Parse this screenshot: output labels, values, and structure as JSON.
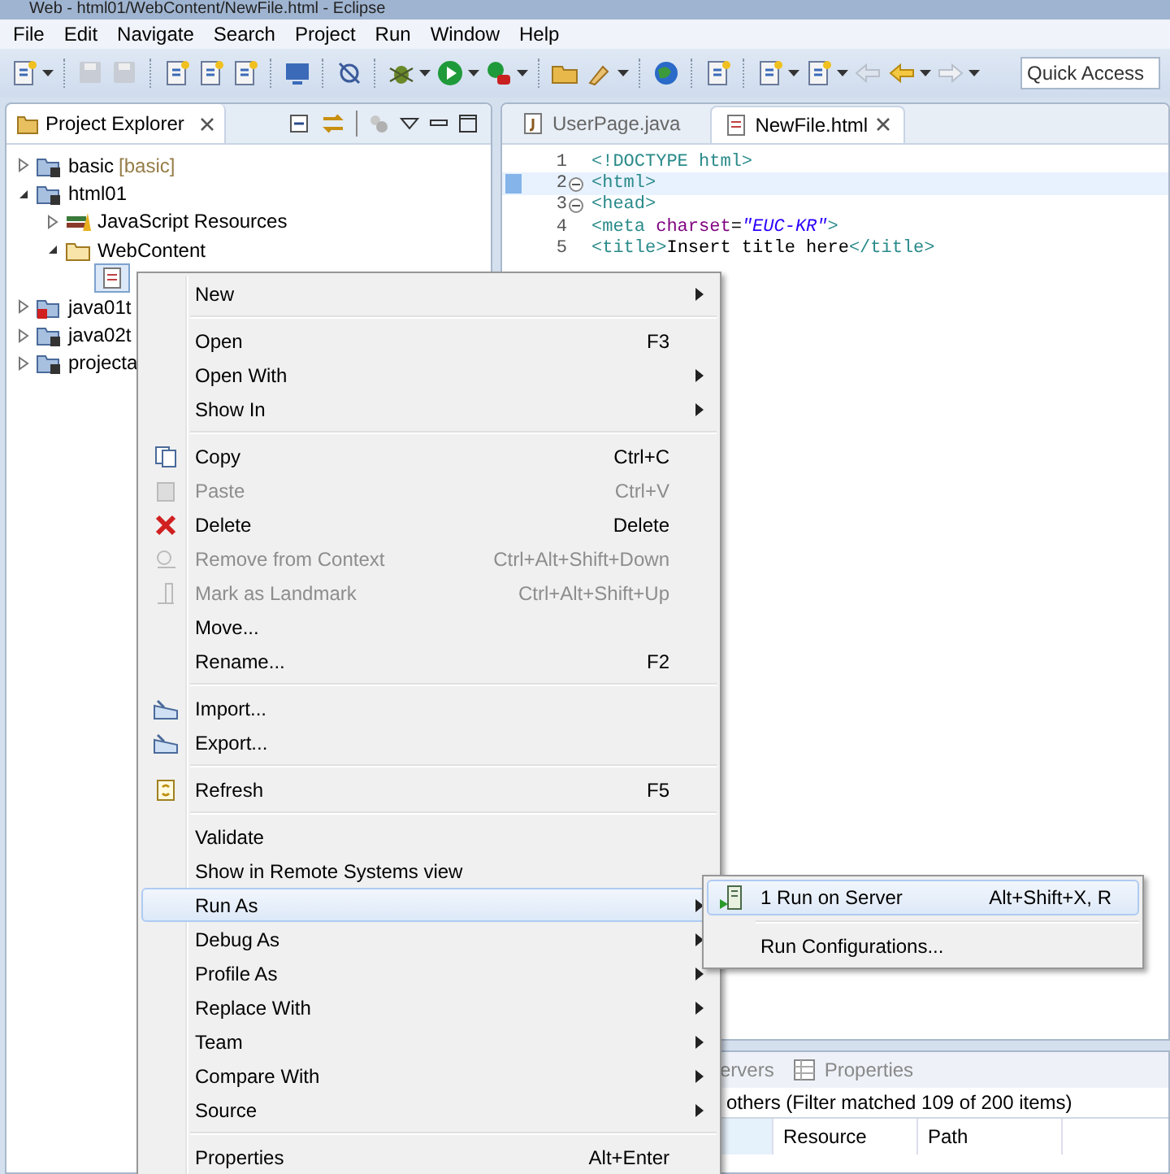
{
  "window": {
    "title": "Web - html01/WebContent/NewFile.html - Eclipse"
  },
  "menu_bar": [
    "File",
    "Edit",
    "Navigate",
    "Search",
    "Project",
    "Run",
    "Window",
    "Help"
  ],
  "toolbar": {
    "search": {
      "placeholder": "Quick Access"
    }
  },
  "project_explorer": {
    "title": "Project Explorer",
    "tree": [
      {
        "label": "basic",
        "suffix": "[basic]",
        "expanded": false
      },
      {
        "label": "html01",
        "expanded": true,
        "children": [
          {
            "label": "JavaScript Resources",
            "expanded": false
          },
          {
            "label": "WebContent",
            "expanded": true,
            "children": [
              {
                "kind": "file",
                "selected": true
              }
            ]
          }
        ]
      },
      {
        "label": "java01t",
        "expanded": false
      },
      {
        "label": "java02t",
        "expanded": false
      },
      {
        "label": "projecta",
        "expanded": false
      }
    ]
  },
  "editor": {
    "tabs": [
      {
        "label": "UserPage.java",
        "selected": false
      },
      {
        "label": "NewFile.html",
        "selected": true
      }
    ],
    "lines": [
      {
        "number": "1",
        "foldable": false,
        "current": false,
        "tokens": [
          {
            "kind": "tag",
            "text": "<!DOCTYPE html>"
          }
        ]
      },
      {
        "number": "2",
        "foldable": true,
        "current": true,
        "tokens": [
          {
            "kind": "tag",
            "text": "<html>"
          }
        ]
      },
      {
        "number": "3",
        "foldable": true,
        "current": false,
        "tokens": [
          {
            "kind": "tag",
            "text": "<head>"
          }
        ]
      },
      {
        "number": "4",
        "foldable": false,
        "current": false,
        "tokens": [
          {
            "kind": "tag",
            "text": "<meta "
          },
          {
            "kind": "attr",
            "text": "charset"
          },
          {
            "kind": "plain",
            "text": "="
          },
          {
            "kind": "value",
            "text": "\"EUC-KR\""
          },
          {
            "kind": "tag",
            "text": ">"
          }
        ]
      },
      {
        "number": "5",
        "foldable": false,
        "current": false,
        "tokens": [
          {
            "kind": "tag",
            "text": "<title>"
          },
          {
            "kind": "plain",
            "text": "Insert title here"
          },
          {
            "kind": "tag",
            "text": "</title>"
          }
        ]
      }
    ]
  },
  "bottom_panel": {
    "tabs": [
      {
        "label": "ervers"
      },
      {
        "label": "Properties"
      }
    ],
    "status": "others (Filter matched 109 of 200 items)",
    "columns": [
      {
        "sorted": true
      },
      {
        "label": "Resource",
        "sorted": false
      },
      {
        "label": "Path",
        "sorted": false
      }
    ]
  },
  "context_menu": {
    "items": [
      {
        "kind": "item",
        "label": "New",
        "submenu": true,
        "disabled": false,
        "selected": false
      },
      {
        "kind": "separator"
      },
      {
        "kind": "item",
        "label": "Open",
        "shortcut": "F3",
        "submenu": false,
        "disabled": false,
        "selected": false
      },
      {
        "kind": "item",
        "label": "Open With",
        "submenu": true,
        "disabled": false,
        "selected": false
      },
      {
        "kind": "item",
        "label": "Show In",
        "submenu": true,
        "disabled": false,
        "selected": false
      },
      {
        "kind": "separator"
      },
      {
        "kind": "item",
        "label": "Copy",
        "shortcut": "Ctrl+C",
        "submenu": false,
        "disabled": false,
        "selected": false
      },
      {
        "kind": "item",
        "label": "Paste",
        "shortcut": "Ctrl+V",
        "submenu": false,
        "disabled": true,
        "selected": false
      },
      {
        "kind": "item",
        "label": "Delete",
        "shortcut": "Delete",
        "submenu": false,
        "disabled": false,
        "selected": false
      },
      {
        "kind": "item",
        "label": "Remove from Context",
        "shortcut": "Ctrl+Alt+Shift+Down",
        "submenu": false,
        "disabled": true,
        "selected": false
      },
      {
        "kind": "item",
        "label": "Mark as Landmark",
        "shortcut": "Ctrl+Alt+Shift+Up",
        "submenu": false,
        "disabled": true,
        "selected": false
      },
      {
        "kind": "item",
        "label": "Move...",
        "submenu": false,
        "disabled": false,
        "selected": false
      },
      {
        "kind": "item",
        "label": "Rename...",
        "shortcut": "F2",
        "submenu": false,
        "disabled": false,
        "selected": false
      },
      {
        "kind": "separator"
      },
      {
        "kind": "item",
        "label": "Import...",
        "submenu": false,
        "disabled": false,
        "selected": false
      },
      {
        "kind": "item",
        "label": "Export...",
        "submenu": false,
        "disabled": false,
        "selected": false
      },
      {
        "kind": "separator"
      },
      {
        "kind": "item",
        "label": "Refresh",
        "shortcut": "F5",
        "submenu": false,
        "disabled": false,
        "selected": false
      },
      {
        "kind": "separator"
      },
      {
        "kind": "item",
        "label": "Validate",
        "submenu": false,
        "disabled": false,
        "selected": false
      },
      {
        "kind": "item",
        "label": "Show in Remote Systems view",
        "submenu": false,
        "disabled": false,
        "selected": false
      },
      {
        "kind": "item",
        "label": "Run As",
        "submenu": true,
        "disabled": false,
        "selected": true
      },
      {
        "kind": "item",
        "label": "Debug As",
        "submenu": true,
        "disabled": false,
        "selected": false
      },
      {
        "kind": "item",
        "label": "Profile As",
        "submenu": true,
        "disabled": false,
        "selected": false
      },
      {
        "kind": "item",
        "label": "Replace With",
        "submenu": true,
        "disabled": false,
        "selected": false
      },
      {
        "kind": "item",
        "label": "Team",
        "submenu": true,
        "disabled": false,
        "selected": false
      },
      {
        "kind": "item",
        "label": "Compare With",
        "submenu": true,
        "disabled": false,
        "selected": false
      },
      {
        "kind": "item",
        "label": "Source",
        "submenu": true,
        "disabled": false,
        "selected": false
      },
      {
        "kind": "separator"
      },
      {
        "kind": "item",
        "label": "Properties",
        "shortcut": "Alt+Enter",
        "submenu": false,
        "disabled": false,
        "selected": false
      }
    ]
  },
  "submenu": {
    "items": [
      {
        "kind": "item",
        "label": "1 Run on Server",
        "shortcut": "Alt+Shift+X, R",
        "selected": true
      },
      {
        "kind": "separator"
      },
      {
        "kind": "item",
        "label": "Run Configurations...",
        "selected": false
      }
    ]
  }
}
